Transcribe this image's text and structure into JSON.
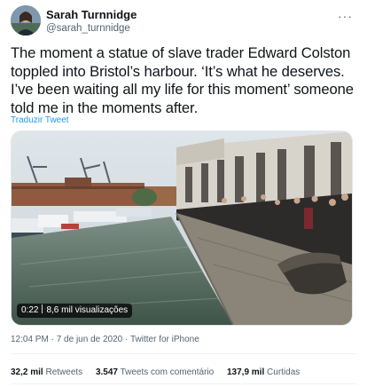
{
  "user": {
    "display_name": "Sarah Turnnidge",
    "handle": "@sarah_turnnidge"
  },
  "tweet": {
    "text": "The moment a statue of slave trader Edward Colston toppled into Bristol’s harbour. ‘It’s what he deserves. I’ve been waiting all my life for this moment’ someone told me in the moments after.",
    "translate_label": "Traduzir Tweet",
    "more_icon": "more-horizontal-icon"
  },
  "video": {
    "duration": "0:22",
    "views": "8,6 mil visualizações"
  },
  "meta": {
    "time": "12:04 PM",
    "separator": "·",
    "date": "7 de jun de 2020",
    "source": "Twitter for iPhone"
  },
  "stats": {
    "retweets_count": "32,2 mil",
    "retweets_label": "Retweets",
    "quotes_count": "3.547",
    "quotes_label": "Tweets com comentário",
    "likes_count": "137,9 mil",
    "likes_label": "Curtidas"
  },
  "colors": {
    "link": "#1d9bf0",
    "secondary_text": "#536471",
    "primary_text": "#0f1419"
  }
}
